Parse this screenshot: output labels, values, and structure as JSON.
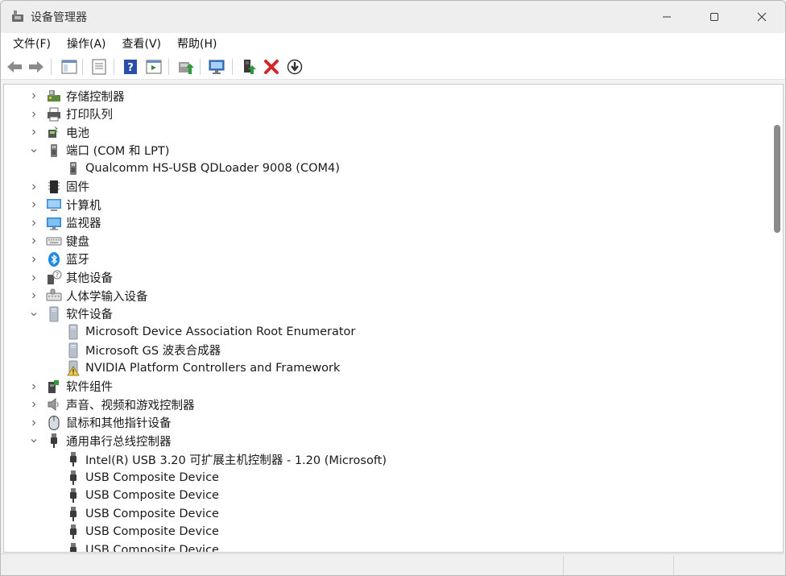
{
  "window": {
    "title": "设备管理器",
    "controls": {
      "minimize": "minimize-icon",
      "maximize": "maximize-icon",
      "close": "close-icon"
    }
  },
  "menu": [
    {
      "label": "文件(F)"
    },
    {
      "label": "操作(A)"
    },
    {
      "label": "查看(V)"
    },
    {
      "label": "帮助(H)"
    }
  ],
  "toolbar": {
    "icons": [
      "back-arrow-icon",
      "forward-arrow-icon",
      "show-hide-console-tree-icon",
      "properties-icon",
      "help-icon",
      "action-pane-icon",
      "update-driver-icon",
      "scan-hardware-icon",
      "add-legacy-hardware-icon",
      "uninstall-device-icon",
      "disable-device-icon"
    ]
  },
  "tree": [
    {
      "label": "存储控制器",
      "expanded": false,
      "icon": "storage-controller-icon"
    },
    {
      "label": "打印队列",
      "expanded": false,
      "icon": "printer-icon"
    },
    {
      "label": "电池",
      "expanded": false,
      "icon": "battery-icon"
    },
    {
      "label": "端口 (COM 和 LPT)",
      "expanded": true,
      "icon": "port-icon"
    },
    {
      "label": "Qualcomm HS-USB QDLoader 9008 (COM4)",
      "child": true,
      "icon": "port-icon"
    },
    {
      "label": "固件",
      "expanded": false,
      "icon": "firmware-icon"
    },
    {
      "label": "计算机",
      "expanded": false,
      "icon": "computer-icon"
    },
    {
      "label": "监视器",
      "expanded": false,
      "icon": "monitor-icon"
    },
    {
      "label": "键盘",
      "expanded": false,
      "icon": "keyboard-icon"
    },
    {
      "label": "蓝牙",
      "expanded": false,
      "icon": "bluetooth-icon"
    },
    {
      "label": "其他设备",
      "expanded": false,
      "icon": "other-devices-icon"
    },
    {
      "label": "人体学输入设备",
      "expanded": false,
      "icon": "hid-icon"
    },
    {
      "label": "软件设备",
      "expanded": true,
      "icon": "software-device-icon"
    },
    {
      "label": "Microsoft Device Association Root Enumerator",
      "child": true,
      "icon": "software-device-icon"
    },
    {
      "label": "Microsoft GS 波表合成器",
      "child": true,
      "icon": "software-device-icon"
    },
    {
      "label": "NVIDIA Platform Controllers and Framework",
      "child": true,
      "icon": "warning-device-icon"
    },
    {
      "label": "软件组件",
      "expanded": false,
      "icon": "software-component-icon"
    },
    {
      "label": "声音、视频和游戏控制器",
      "expanded": false,
      "icon": "speaker-icon"
    },
    {
      "label": "鼠标和其他指针设备",
      "expanded": false,
      "icon": "mouse-icon"
    },
    {
      "label": "通用串行总线控制器",
      "expanded": true,
      "icon": "usb-icon"
    },
    {
      "label": "Intel(R) USB 3.20 可扩展主机控制器 - 1.20 (Microsoft)",
      "child": true,
      "icon": "usb-icon"
    },
    {
      "label": "USB Composite Device",
      "child": true,
      "icon": "usb-icon"
    },
    {
      "label": "USB Composite Device",
      "child": true,
      "icon": "usb-icon"
    },
    {
      "label": "USB Composite Device",
      "child": true,
      "icon": "usb-icon"
    },
    {
      "label": "USB Composite Device",
      "child": true,
      "icon": "usb-icon"
    },
    {
      "label": "USB Composite Device",
      "child": true,
      "icon": "usb-icon"
    }
  ],
  "colors": {
    "accent": "#0078d4",
    "warning": "#f2c94c",
    "error": "#d52626",
    "bluetooth": "#1e88e5"
  }
}
